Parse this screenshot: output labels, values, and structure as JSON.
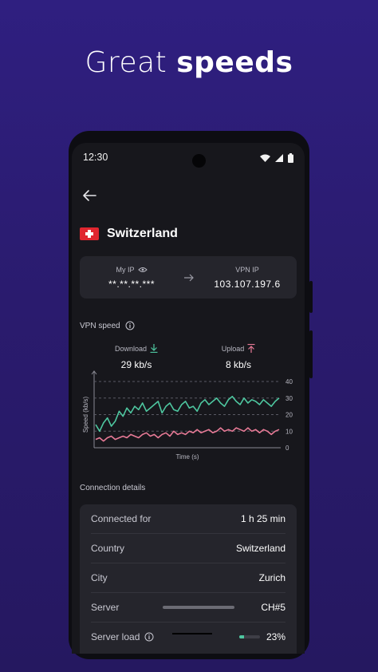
{
  "headline": {
    "light": "Great",
    "bold": "speeds"
  },
  "status_bar": {
    "time": "12:30"
  },
  "header": {
    "country": "Switzerland"
  },
  "ip_card": {
    "my_ip_label": "My IP",
    "my_ip_value": "**.**.**.***",
    "vpn_ip_label": "VPN IP",
    "vpn_ip_value": "103.107.197.6"
  },
  "speed": {
    "title": "VPN speed",
    "download_label": "Download",
    "download_value": "29 kb/s",
    "upload_label": "Upload",
    "upload_value": "8 kb/s"
  },
  "chart_data": {
    "type": "line",
    "xlabel": "Time (s)",
    "ylabel": "Speed (kb/s)",
    "ylim": [
      0,
      40
    ],
    "yticks": [
      0,
      10,
      20,
      30,
      40
    ],
    "grid": true,
    "series": [
      {
        "color": "#4ec7a0",
        "values": [
          14,
          10,
          15,
          18,
          13,
          16,
          22,
          19,
          24,
          21,
          25,
          23,
          27,
          22,
          24,
          26,
          28,
          21,
          25,
          27,
          23,
          22,
          26,
          28,
          24,
          25,
          22,
          27,
          29,
          26,
          28,
          30,
          27,
          25,
          29,
          31,
          28,
          26,
          30,
          27,
          29,
          28,
          26,
          29,
          27,
          25,
          28,
          30
        ]
      },
      {
        "color": "#e77a96",
        "values": [
          5,
          6,
          4,
          6,
          7,
          5,
          6,
          7,
          6,
          8,
          7,
          6,
          8,
          9,
          7,
          8,
          6,
          8,
          9,
          7,
          10,
          8,
          9,
          8,
          10,
          9,
          11,
          9,
          10,
          11,
          9,
          10,
          12,
          10,
          11,
          10,
          12,
          11,
          10,
          12,
          10,
          11,
          9,
          11,
          10,
          8,
          10,
          11
        ]
      }
    ]
  },
  "details": {
    "title": "Connection details",
    "rows": [
      {
        "label": "Connected for",
        "value": "1 h 25 min"
      },
      {
        "label": "Country",
        "value": "Switzerland"
      },
      {
        "label": "City",
        "value": "Zurich"
      },
      {
        "label": "Server",
        "value": "CH#5"
      },
      {
        "label": "Server load",
        "value": "23%",
        "load": 0.23
      }
    ]
  },
  "colors": {
    "accent_green": "#4ec7a0",
    "accent_pink": "#e77a96",
    "background": "#2f1f80"
  }
}
